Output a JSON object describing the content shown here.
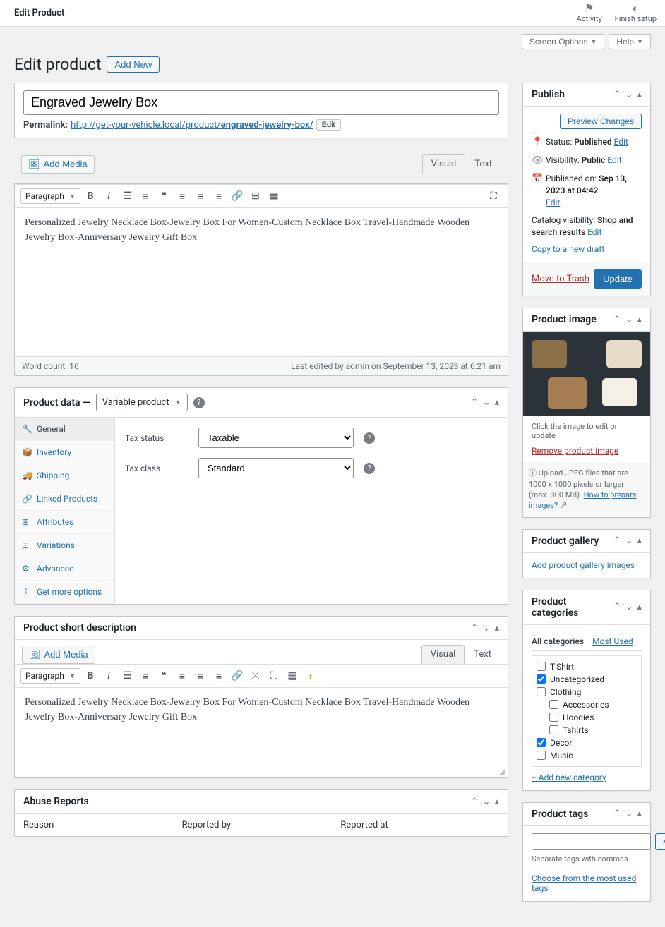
{
  "topbar": {
    "title": "Edit Product",
    "actions": [
      {
        "icon": "⚑",
        "label": "Activity"
      },
      {
        "icon": "◐",
        "label": "Finish setup"
      }
    ]
  },
  "screenMeta": {
    "screenOptions": "Screen Options",
    "help": "Help"
  },
  "heading": "Edit product",
  "addNew": "Add New",
  "title": "Engraved Jewelry Box",
  "permalink": {
    "label": "Permalink:",
    "base": "http://get-your-vehicle.local/product/",
    "slug": "engraved-jewelry-box/",
    "edit": "Edit"
  },
  "addMedia": "Add Media",
  "editorTabs": {
    "visual": "Visual",
    "text": "Text"
  },
  "paragraphLabel": "Paragraph",
  "mainContent": "Personalized Jewelry Necklace Box-Jewelry Box For Women-Custom Necklace Box Travel-Handmade Wooden Jewelry Box-Anniversary Jewelry Gift Box",
  "wordCount": "Word count: 16",
  "lastEdited": "Last edited by admin on September 13, 2023 at 6:21 am",
  "productData": {
    "title": "Product data —",
    "typeValue": "Variable product",
    "tabs": [
      {
        "icon": "🔧",
        "label": "General",
        "active": true
      },
      {
        "icon": "📦",
        "label": "Inventory"
      },
      {
        "icon": "🚚",
        "label": "Shipping"
      },
      {
        "icon": "🔗",
        "label": "Linked Products"
      },
      {
        "icon": "⊞",
        "label": "Attributes"
      },
      {
        "icon": "⊡",
        "label": "Variations"
      },
      {
        "icon": "⚙",
        "label": "Advanced"
      },
      {
        "icon": "⋮",
        "label": "Get more options"
      }
    ],
    "taxStatus": {
      "label": "Tax status",
      "value": "Taxable"
    },
    "taxClass": {
      "label": "Tax class",
      "value": "Standard"
    }
  },
  "shortDesc": {
    "title": "Product short description",
    "content": "Personalized Jewelry Necklace Box-Jewelry Box For Women-Custom Necklace Box Travel-Handmade Wooden Jewelry Box-Anniversary Jewelry Gift Box"
  },
  "abuse": {
    "title": "Abuse Reports",
    "cols": [
      "Reason",
      "Reported by",
      "Reported at"
    ]
  },
  "publish": {
    "title": "Publish",
    "preview": "Preview Changes",
    "status": {
      "label": "Status:",
      "value": "Published",
      "edit": "Edit"
    },
    "visibility": {
      "label": "Visibility:",
      "value": "Public",
      "edit": "Edit"
    },
    "published": {
      "label": "Published on:",
      "value": "Sep 13, 2023 at 04:42",
      "edit": "Edit"
    },
    "catalog": {
      "label": "Catalog visibility:",
      "value": "Shop and search results",
      "edit": "Edit"
    },
    "copy": "Copy to a new draft",
    "trash": "Move to Trash",
    "update": "Update"
  },
  "productImage": {
    "title": "Product image",
    "clickHint": "Click the image to edit or update",
    "remove": "Remove product image",
    "uploadHint": "Upload JPEG files that are 1000 x 1000 pixels or larger (max. 300 MB).",
    "howTo": "How to prepare images?"
  },
  "gallery": {
    "title": "Product gallery",
    "addLink": "Add product gallery images"
  },
  "categories": {
    "title": "Product categories",
    "tabs": {
      "all": "All categories",
      "most": "Most Used"
    },
    "items": [
      {
        "label": "T-Shirt",
        "checked": false,
        "child": false
      },
      {
        "label": "Uncategorized",
        "checked": true,
        "child": false
      },
      {
        "label": "Clothing",
        "checked": false,
        "child": false
      },
      {
        "label": "Accessories",
        "checked": false,
        "child": true
      },
      {
        "label": "Hoodies",
        "checked": false,
        "child": true
      },
      {
        "label": "Tshirts",
        "checked": false,
        "child": true
      },
      {
        "label": "Decor",
        "checked": true,
        "child": false
      },
      {
        "label": "Music",
        "checked": false,
        "child": false
      }
    ],
    "addNew": "+ Add new category"
  },
  "tags": {
    "title": "Product tags",
    "add": "Add",
    "hint": "Separate tags with commas",
    "chooseLink": "Choose from the most used tags"
  }
}
